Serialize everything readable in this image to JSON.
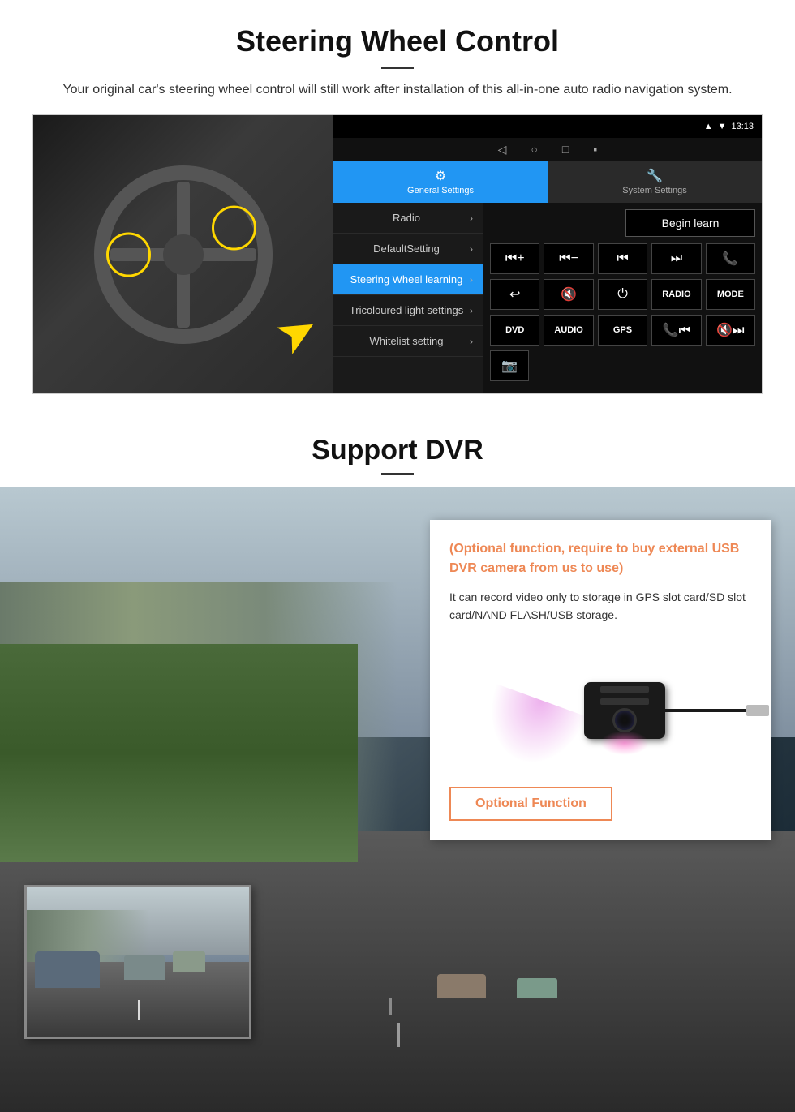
{
  "steering": {
    "title": "Steering Wheel Control",
    "subtitle": "Your original car's steering wheel control will still work after installation of this all-in-one auto radio navigation system.",
    "status_bar": {
      "time": "13:13",
      "icons": [
        "signal",
        "wifi",
        "battery"
      ]
    },
    "tabs": {
      "general": "General Settings",
      "system": "System Settings"
    },
    "menu_items": [
      {
        "label": "Radio",
        "active": false
      },
      {
        "label": "DefaultSetting",
        "active": false
      },
      {
        "label": "Steering Wheel learning",
        "active": true
      },
      {
        "label": "Tricoloured light settings",
        "active": false
      },
      {
        "label": "Whitelist setting",
        "active": false
      }
    ],
    "begin_learn": "Begin learn",
    "control_buttons": {
      "row1": [
        "⏮+",
        "⏮-",
        "⏮",
        "⏭",
        "📞"
      ],
      "row2": [
        "↩",
        "🔇",
        "⏻",
        "RADIO",
        "MODE"
      ],
      "row3": [
        "DVD",
        "AUDIO",
        "GPS",
        "📞⏮",
        "🔇⏭"
      ]
    }
  },
  "dvr": {
    "title": "Support DVR",
    "optional_text": "(Optional function, require to buy external USB DVR camera from us to use)",
    "description": "It can record video only to storage in GPS slot card/SD slot card/NAND FLASH/USB storage.",
    "optional_button": "Optional Function"
  }
}
